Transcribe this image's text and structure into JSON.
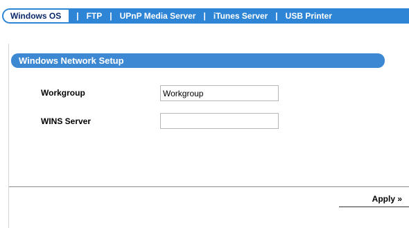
{
  "nav": {
    "tabs": [
      {
        "label": "Windows OS",
        "active": true
      },
      {
        "label": "FTP",
        "active": false
      },
      {
        "label": "UPnP Media Server",
        "active": false
      },
      {
        "label": "iTunes Server",
        "active": false
      },
      {
        "label": "USB Printer",
        "active": false
      }
    ],
    "separator": "|"
  },
  "section": {
    "title": "Windows Network Setup"
  },
  "form": {
    "workgroup_label": "Workgroup",
    "workgroup_value": "Workgroup",
    "wins_label": "WINS Server",
    "wins_value": ""
  },
  "apply": {
    "label": "Apply »"
  },
  "colors": {
    "nav_bg": "#2f85d5",
    "header_bg": "#3d88d2",
    "active_tab_text": "#0b2a6b"
  }
}
